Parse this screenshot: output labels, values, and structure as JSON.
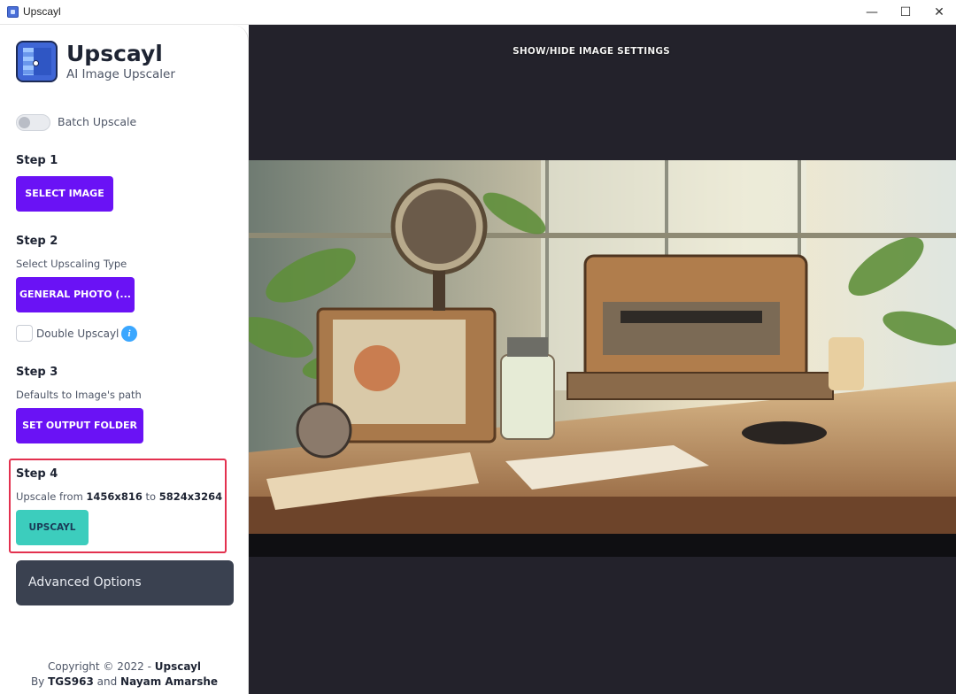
{
  "window": {
    "title": "Upscayl",
    "minimize_glyph": "—",
    "maximize_glyph": "☐",
    "close_glyph": "✕"
  },
  "brand": {
    "name": "Upscayl",
    "tagline": "AI Image Upscaler"
  },
  "batch": {
    "label": "Batch Upscale",
    "enabled": false
  },
  "step1": {
    "title": "Step 1",
    "button": "SELECT IMAGE"
  },
  "step2": {
    "title": "Step 2",
    "subtitle": "Select Upscaling Type",
    "button": "GENERAL PHOTO (...",
    "double_label": "Double Upscayl",
    "double_checked": false,
    "info_icon": "info-icon"
  },
  "step3": {
    "title": "Step 3",
    "subtitle": "Defaults to Image's path",
    "button": "SET OUTPUT FOLDER"
  },
  "step4": {
    "title": "Step 4",
    "upscale_prefix": "Upscale from ",
    "from_size": "1456x816",
    "to_word": " to ",
    "to_size": "5824x3264",
    "button": "UPSCAYL"
  },
  "advanced": {
    "label": "Advanced Options"
  },
  "footer": {
    "copyright_prefix": "Copyright © 2022 - ",
    "copyright_brand": "Upscayl",
    "by_prefix": "By ",
    "author1": "TGS963",
    "and_word": " and ",
    "author2": "Nayam Amarshe"
  },
  "main": {
    "settings_toggle": "SHOW/HIDE IMAGE SETTINGS",
    "preview_image": "vintage-radio-desk-illustration"
  },
  "colors": {
    "primary": "#6a12f5",
    "upscayl": "#3ccdbd",
    "advanced_bg": "#3a4150",
    "main_bg": "#23222b",
    "highlight": "#e3314f"
  }
}
